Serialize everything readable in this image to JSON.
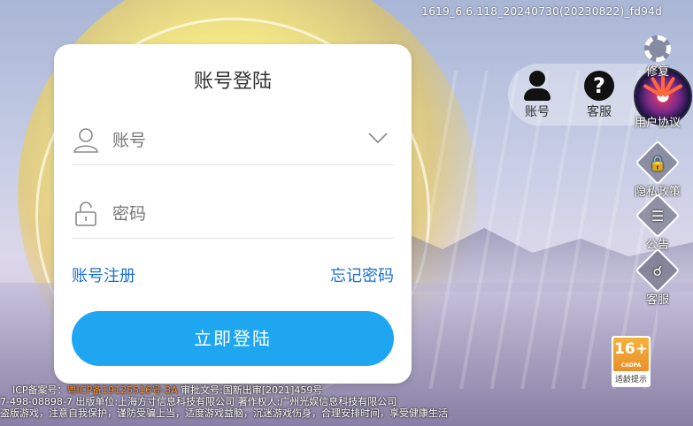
{
  "version_text": "1619_6.6.118_20240730(20230822)_fd94d",
  "login": {
    "title": "账号登陆",
    "account_placeholder": "账号",
    "password_placeholder": "密码",
    "register_link": "账号注册",
    "forgot_link": "忘记密码",
    "login_button": "立即登陆"
  },
  "account_panel": {
    "account_label": "账号",
    "service_label": "客服"
  },
  "sidebar": {
    "settings": "修复",
    "user_agreement": "用户协议",
    "privacy": "隐私政策",
    "notice": "公告",
    "support": "客服"
  },
  "age_rating": {
    "age": "16+",
    "org": "CADPA",
    "label": "适龄提示"
  },
  "footer": {
    "icp_prefix": "ICP备案号：",
    "icp_number": "粤ICP备19125516号-3A",
    "approval": "  审批文号:国新出审[2021]459号",
    "line2": "7-498-08898-7  出版单位:上海方寸信息科技有限公司  著作权人:广州光娱信息科技有限公司",
    "line3": "盗版游戏，注意自我保护，谨防受骗上当，适度游戏益脑，沉迷游戏伤身，合理安排时间，享受健康生活"
  }
}
